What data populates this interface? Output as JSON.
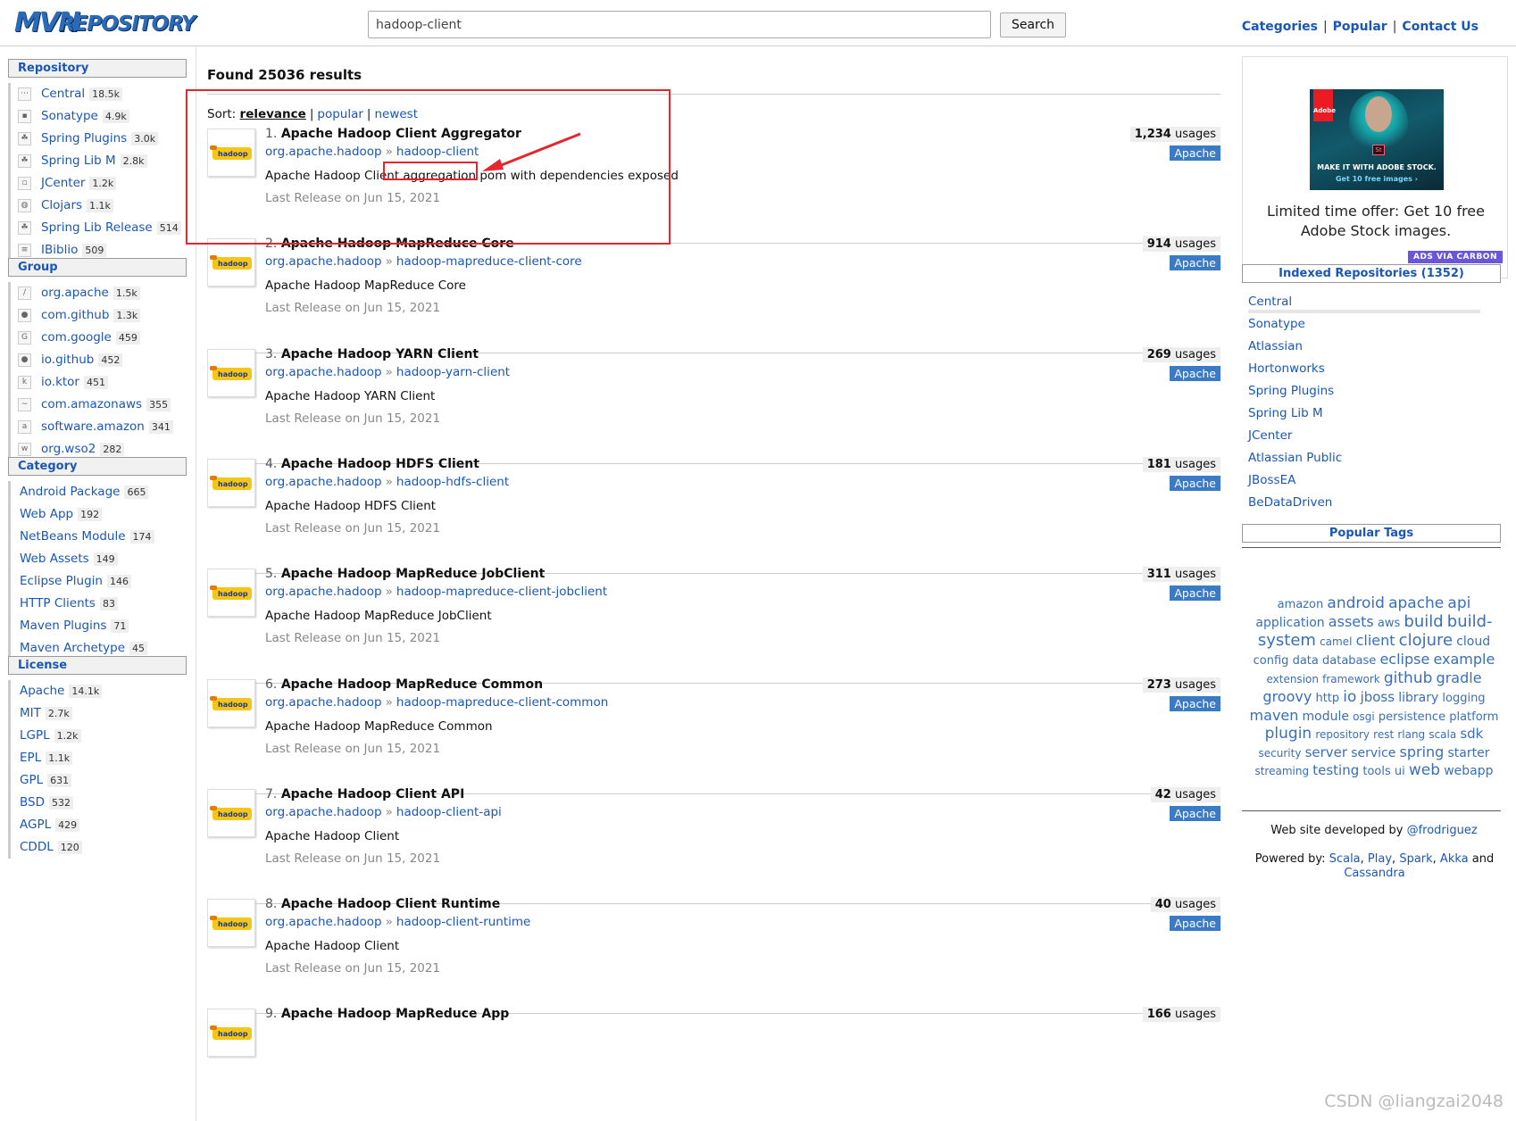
{
  "header": {
    "logo_part1": "MVN",
    "logo_part2": "REPOSITORY",
    "search_value": "hadoop-client",
    "search_button": "Search",
    "nav": [
      "Categories",
      "Popular",
      "Contact Us"
    ],
    "nav_separator": "|"
  },
  "left": {
    "repository": {
      "title": "Repository",
      "items": [
        {
          "label": "Central",
          "count": "18.5k",
          "icon": "central-icon"
        },
        {
          "label": "Sonatype",
          "count": "4.9k",
          "icon": "sonatype-icon"
        },
        {
          "label": "Spring Plugins",
          "count": "3.0k",
          "icon": "spring-icon"
        },
        {
          "label": "Spring Lib M",
          "count": "2.8k",
          "icon": "spring-icon"
        },
        {
          "label": "JCenter",
          "count": "1.2k",
          "icon": "jcenter-icon"
        },
        {
          "label": "Clojars",
          "count": "1.1k",
          "icon": "clojars-icon"
        },
        {
          "label": "Spring Lib Release",
          "count": "514",
          "icon": "spring-icon"
        },
        {
          "label": "IBiblio",
          "count": "509",
          "icon": "ibiblio-icon"
        }
      ]
    },
    "group": {
      "title": "Group",
      "items": [
        {
          "label": "org.apache",
          "count": "1.5k",
          "icon": "apache-feather-icon"
        },
        {
          "label": "com.github",
          "count": "1.3k",
          "icon": "github-icon"
        },
        {
          "label": "com.google",
          "count": "459",
          "icon": "google-icon"
        },
        {
          "label": "io.github",
          "count": "452",
          "icon": "github-icon"
        },
        {
          "label": "io.ktor",
          "count": "451",
          "icon": "ktor-icon"
        },
        {
          "label": "com.amazonaws",
          "count": "355",
          "icon": "aws-icon"
        },
        {
          "label": "software.amazon",
          "count": "341",
          "icon": "amazon-icon"
        },
        {
          "label": "org.wso2",
          "count": "282",
          "icon": "wso2-icon"
        }
      ]
    },
    "category": {
      "title": "Category",
      "items": [
        {
          "label": "Android Package",
          "count": "665"
        },
        {
          "label": "Web App",
          "count": "192"
        },
        {
          "label": "NetBeans Module",
          "count": "174"
        },
        {
          "label": "Web Assets",
          "count": "149"
        },
        {
          "label": "Eclipse Plugin",
          "count": "146"
        },
        {
          "label": "HTTP Clients",
          "count": "83"
        },
        {
          "label": "Maven Plugins",
          "count": "71"
        },
        {
          "label": "Maven Archetype",
          "count": "45"
        }
      ]
    },
    "license": {
      "title": "License",
      "items": [
        {
          "label": "Apache",
          "count": "14.1k"
        },
        {
          "label": "MIT",
          "count": "2.7k"
        },
        {
          "label": "LGPL",
          "count": "1.2k"
        },
        {
          "label": "EPL",
          "count": "1.1k"
        },
        {
          "label": "GPL",
          "count": "631"
        },
        {
          "label": "BSD",
          "count": "532"
        },
        {
          "label": "AGPL",
          "count": "429"
        },
        {
          "label": "CDDL",
          "count": "120"
        }
      ]
    }
  },
  "main": {
    "found_text": "Found 25036 results",
    "sort_label": "Sort:",
    "sort_options": [
      "relevance",
      "popular",
      "newest"
    ],
    "sort_separator": "|",
    "results": [
      {
        "num": "1.",
        "name": "Apache Hadoop Client Aggregator",
        "group": "org.apache.hadoop",
        "artifact": "hadoop-client",
        "desc": "Apache Hadoop Client aggregation pom with dependencies exposed",
        "release": "Last Release on Jun 15, 2021",
        "usages": "1,234",
        "license": "Apache"
      },
      {
        "num": "2.",
        "name": "Apache Hadoop MapReduce Core",
        "group": "org.apache.hadoop",
        "artifact": "hadoop-mapreduce-client-core",
        "desc": "Apache Hadoop MapReduce Core",
        "release": "Last Release on Jun 15, 2021",
        "usages": "914",
        "license": "Apache"
      },
      {
        "num": "3.",
        "name": "Apache Hadoop YARN Client",
        "group": "org.apache.hadoop",
        "artifact": "hadoop-yarn-client",
        "desc": "Apache Hadoop YARN Client",
        "release": "Last Release on Jun 15, 2021",
        "usages": "269",
        "license": "Apache"
      },
      {
        "num": "4.",
        "name": "Apache Hadoop HDFS Client",
        "group": "org.apache.hadoop",
        "artifact": "hadoop-hdfs-client",
        "desc": "Apache Hadoop HDFS Client",
        "release": "Last Release on Jun 15, 2021",
        "usages": "181",
        "license": "Apache"
      },
      {
        "num": "5.",
        "name": "Apache Hadoop MapReduce JobClient",
        "group": "org.apache.hadoop",
        "artifact": "hadoop-mapreduce-client-jobclient",
        "desc": "Apache Hadoop MapReduce JobClient",
        "release": "Last Release on Jun 15, 2021",
        "usages": "311",
        "license": "Apache"
      },
      {
        "num": "6.",
        "name": "Apache Hadoop MapReduce Common",
        "group": "org.apache.hadoop",
        "artifact": "hadoop-mapreduce-client-common",
        "desc": "Apache Hadoop MapReduce Common",
        "release": "Last Release on Jun 15, 2021",
        "usages": "273",
        "license": "Apache"
      },
      {
        "num": "7.",
        "name": "Apache Hadoop Client API",
        "group": "org.apache.hadoop",
        "artifact": "hadoop-client-api",
        "desc": "Apache Hadoop Client",
        "release": "Last Release on Jun 15, 2021",
        "usages": "42",
        "license": "Apache"
      },
      {
        "num": "8.",
        "name": "Apache Hadoop Client Runtime",
        "group": "org.apache.hadoop",
        "artifact": "hadoop-client-runtime",
        "desc": "Apache Hadoop Client",
        "release": "Last Release on Jun 15, 2021",
        "usages": "40",
        "license": "Apache"
      },
      {
        "num": "9.",
        "name": "Apache Hadoop MapReduce App",
        "group": "",
        "artifact": "",
        "desc": "",
        "release": "",
        "usages": "166",
        "license": ""
      }
    ],
    "usages_suffix": "usages",
    "arrow_glyph": "»"
  },
  "right": {
    "ad": {
      "brand": "Adobe",
      "badge": "St",
      "img_line1": "MAKE IT WITH ADOBE STOCK.",
      "img_line2": "Get 10 free images ›",
      "text": "Limited time offer: Get 10 free Adobe Stock images.",
      "via": "ADS VIA CARBON"
    },
    "indexed": {
      "title": "Indexed Repositories (1352)",
      "items": [
        {
          "label": "Central",
          "share": 1.0
        },
        {
          "label": "Sonatype",
          "share": 0.0
        },
        {
          "label": "Atlassian",
          "share": 0.0
        },
        {
          "label": "Hortonworks",
          "share": 0.0
        },
        {
          "label": "Spring Plugins",
          "share": 0.0
        },
        {
          "label": "Spring Lib M",
          "share": 0.0
        },
        {
          "label": "JCenter",
          "share": 0.0
        },
        {
          "label": "Atlassian Public",
          "share": 0.0
        },
        {
          "label": "JBossEA",
          "share": 0.0
        },
        {
          "label": "BeDataDriven",
          "share": 0.0
        }
      ]
    },
    "popular_tags": {
      "title": "Popular Tags",
      "tags": [
        {
          "t": "amazon",
          "s": 13
        },
        {
          "t": "android",
          "s": 17
        },
        {
          "t": "apache",
          "s": 17
        },
        {
          "t": "api",
          "s": 17
        },
        {
          "t": "application",
          "s": 14
        },
        {
          "t": "assets",
          "s": 16
        },
        {
          "t": "aws",
          "s": 13
        },
        {
          "t": "build",
          "s": 18
        },
        {
          "t": "build-system",
          "s": 18
        },
        {
          "t": "camel",
          "s": 12
        },
        {
          "t": "client",
          "s": 16
        },
        {
          "t": "clojure",
          "s": 18
        },
        {
          "t": "cloud",
          "s": 14
        },
        {
          "t": "config",
          "s": 13
        },
        {
          "t": "data",
          "s": 13
        },
        {
          "t": "database",
          "s": 13
        },
        {
          "t": "eclipse",
          "s": 16
        },
        {
          "t": "example",
          "s": 16
        },
        {
          "t": "extension",
          "s": 12
        },
        {
          "t": "framework",
          "s": 12
        },
        {
          "t": "github",
          "s": 17
        },
        {
          "t": "gradle",
          "s": 16
        },
        {
          "t": "groovy",
          "s": 16
        },
        {
          "t": "http",
          "s": 13
        },
        {
          "t": "io",
          "s": 17
        },
        {
          "t": "jboss",
          "s": 15
        },
        {
          "t": "library",
          "s": 14
        },
        {
          "t": "logging",
          "s": 13
        },
        {
          "t": "maven",
          "s": 16
        },
        {
          "t": "module",
          "s": 14
        },
        {
          "t": "osgi",
          "s": 12
        },
        {
          "t": "persistence",
          "s": 13
        },
        {
          "t": "platform",
          "s": 13
        },
        {
          "t": "plugin",
          "s": 17
        },
        {
          "t": "repository",
          "s": 12
        },
        {
          "t": "rest",
          "s": 12
        },
        {
          "t": "rlang",
          "s": 12
        },
        {
          "t": "scala",
          "s": 12
        },
        {
          "t": "sdk",
          "s": 15
        },
        {
          "t": "security",
          "s": 12
        },
        {
          "t": "server",
          "s": 15
        },
        {
          "t": "service",
          "s": 14
        },
        {
          "t": "spring",
          "s": 16
        },
        {
          "t": "starter",
          "s": 14
        },
        {
          "t": "streaming",
          "s": 12
        },
        {
          "t": "testing",
          "s": 15
        },
        {
          "t": "tools",
          "s": 13
        },
        {
          "t": "ui",
          "s": 13
        },
        {
          "t": "web",
          "s": 17
        },
        {
          "t": "webapp",
          "s": 14
        }
      ]
    },
    "footer": {
      "dev_prefix": "Web site developed by",
      "dev_handle": "@frodriguez",
      "powered_prefix": "Powered by:",
      "powered_items": [
        "Scala",
        "Play",
        "Spark",
        "Akka",
        "Cassandra"
      ],
      "powered_and": "and"
    }
  },
  "watermark": "CSDN @liangzai2048",
  "colors": {
    "link": "#1a57b5",
    "license_badge": "#3b7ac4",
    "highlight": "#e5262e",
    "ads_badge": "#6b56d8"
  }
}
